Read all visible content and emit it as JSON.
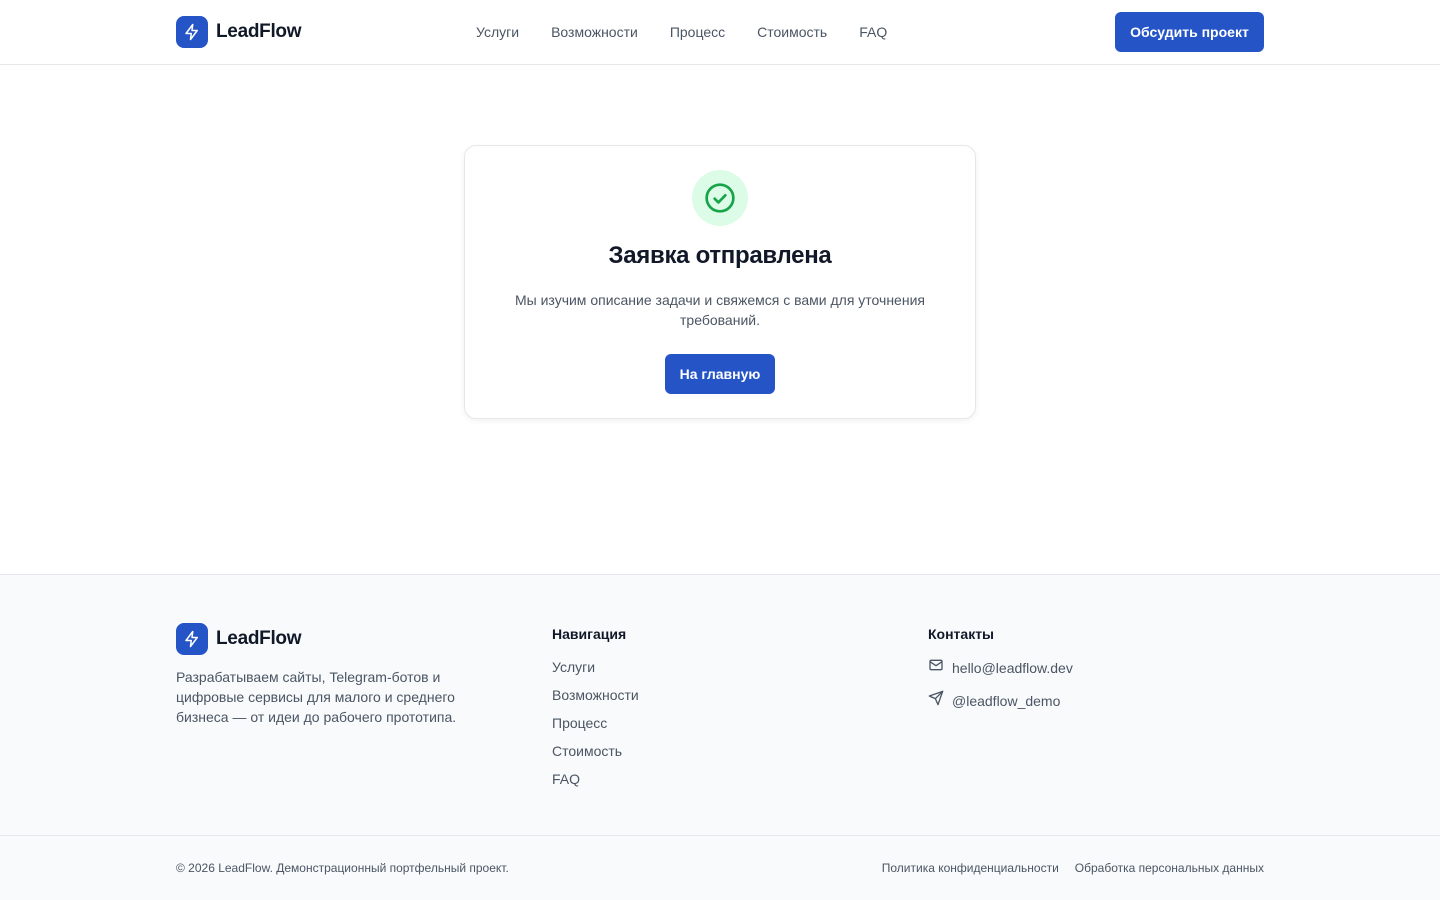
{
  "header": {
    "logo_text": "LeadFlow",
    "nav": [
      "Услуги",
      "Возможности",
      "Процесс",
      "Стоимость",
      "FAQ"
    ],
    "cta_label": "Обсудить проект"
  },
  "success": {
    "icon": "check-circle-icon",
    "title": "Заявка отправлена",
    "text": "Мы изучим описание задачи и свяжемся с вами для уточнения требований.",
    "button_label": "На главную"
  },
  "footer": {
    "logo_text": "LeadFlow",
    "description": "Разрабатываем сайты, Telegram-ботов и цифровые сервисы для малого и среднего бизнеса — от идеи до рабочего прототипа.",
    "nav_title": "Навигация",
    "nav": [
      "Услуги",
      "Возможности",
      "Процесс",
      "Стоимость",
      "FAQ"
    ],
    "contacts_title": "Контакты",
    "email": "hello@leadflow.dev",
    "telegram": "@leadflow_demo",
    "copyright": "© 2026 LeadFlow. Демонстрационный портфельный проект.",
    "legal": [
      "Политика конфиденциальности",
      "Обработка персональных данных"
    ]
  },
  "colors": {
    "brand": "#2554c7",
    "success_bg": "#dcfce7",
    "success_icon": "#16a34a",
    "footer_bg": "#f8fafc",
    "border": "#e5e7eb"
  }
}
